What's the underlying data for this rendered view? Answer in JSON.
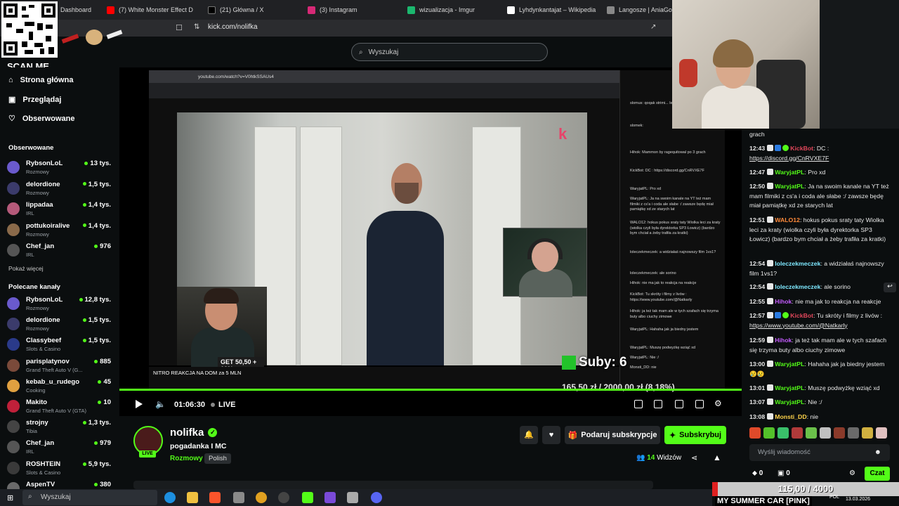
{
  "browser": {
    "tabs": [
      "Dashboard",
      "(7) White Monster Effect D",
      "(21) Główna / X",
      "(3) Instagram",
      "wizualizacja - Imgur",
      "Lyhdynkantajat – Wikipedia",
      "Langosze | AniaGotuje"
    ],
    "url": "kick.com/nolifka"
  },
  "overlay": {
    "scan_me": "SCAN ME",
    "suby": "Suby: 6",
    "goal_text": "165,50 zł / 2000,00 zł (8,18%)",
    "goal2_text": "115,00 / 4000",
    "song": "MY SUMMER CAR [PINK]"
  },
  "header": {
    "search_placeholder": "Wyszukaj"
  },
  "sidebar": {
    "nav": [
      "Strona główna",
      "Przeglądaj",
      "Obserwowane"
    ],
    "followed_title": "Obserwowane",
    "followed": [
      {
        "name": "RybsonLoL",
        "category": "Rozmowy",
        "viewers": "13 tys.",
        "color": "#6a5acd"
      },
      {
        "name": "delordione",
        "category": "Rozmowy",
        "viewers": "1,5 tys.",
        "color": "#3b3b6b"
      },
      {
        "name": "lippadaa",
        "category": "IRL",
        "viewers": "1,4 tys.",
        "color": "#b55a7a"
      },
      {
        "name": "pottukoiralive",
        "category": "Rozmowy",
        "viewers": "1,4 tys.",
        "color": "#8a6a4a"
      },
      {
        "name": "Chef_jan",
        "category": "IRL",
        "viewers": "976",
        "color": "#555555"
      }
    ],
    "show_more": "Pokaż więcej",
    "recommended_title": "Polecane kanały",
    "recommended": [
      {
        "name": "RybsonLoL",
        "category": "Rozmowy",
        "viewers": "12,8 tys.",
        "color": "#6a5acd"
      },
      {
        "name": "delordione",
        "category": "Rozmowy",
        "viewers": "1,5 tys.",
        "color": "#3b3b6b"
      },
      {
        "name": "Classybeef",
        "category": "Slots & Casino",
        "viewers": "1,5 tys.",
        "color": "#2a3a8a"
      },
      {
        "name": "parisplatynov",
        "category": "Grand Theft Auto V (G...",
        "viewers": "885",
        "color": "#7a4a3a"
      },
      {
        "name": "kebab_u_rudego",
        "category": "Cooking",
        "viewers": "45",
        "color": "#e0a040"
      },
      {
        "name": "Makito",
        "category": "Grand Theft Auto V (GTA)",
        "viewers": "10",
        "color": "#c0203a"
      },
      {
        "name": "strojny",
        "category": "Tibia",
        "viewers": "1,3 tys.",
        "color": "#444444"
      },
      {
        "name": "Chef_jan",
        "category": "IRL",
        "viewers": "979",
        "color": "#555555"
      },
      {
        "name": "ROSHTEIN",
        "category": "Slots & Casino",
        "viewers": "5,9 tys.",
        "color": "#3a3a3a"
      },
      {
        "name": "AspenTV",
        "category": "",
        "viewers": "380",
        "color": "#6a6a6a"
      }
    ]
  },
  "video": {
    "inner_url": "youtube.com/watch?v=V0htkSSAUs4",
    "inner_title": "NITRO REAKCJA NA DOM za 5 MLN",
    "get_text": "GET 50,50 + 10%",
    "time": "01:06:30",
    "live": "LIVE",
    "yt_chat": [
      "slomus: qoqak strimi... lepsza jakosc od meduski xD",
      "slomek:",
      "Hihok: Mammon by ragequitowal po 3 grach",
      "KickBot: DC : https://discord.gg/CnRVXE7F",
      "WaryjatPL: Pro xd",
      "WaryjatPL: Ja na swoim kanale na YT też mam filmiki z cs'a i coda ale słabe :/ zawsze będę miał pamiątkę xd ze starych lat",
      "WALO12: hokus pokus sraty taty Wiolka leci za kraty (wiolka czyli była dyrektorka SP3 Łowicz) (bardzo bym chciał a żeby trafiła za kratki)",
      "loleczekmeczek: a widziałaś najnowszy film 1vs1?",
      "loleczekmeczek: ale sorino",
      "Hihok: nie ma jak to reakcja na reakcje",
      "KickBot: Tu skróty i filmy z livów : https://www.youtube.com/@Natkarly",
      "Hihok: ja też tak mam ale w tych szafach się trzyma buty albo ciuchy zimowe",
      "WaryjatPL: Hahaha jak ja biedny jestem",
      "WaryjatPL: Muszę podwyżkę wziąć xd",
      "WaryjatPL: Nie :/",
      "Monsti_DD: nie"
    ]
  },
  "streamer": {
    "name": "nolifka",
    "title": "pogadanka I MC",
    "category": "Rozmowy",
    "language": "Polish",
    "live_badge": "LIVE",
    "gift_label": "Podaruj subskrypcje",
    "subscribe_label": "Subskrybuj",
    "viewers_count": "14",
    "viewers_label": "Widzów"
  },
  "chat": {
    "messages": [
      {
        "time": "",
        "user": "",
        "color": "#ffffff",
        "text": "grach"
      },
      {
        "time": "12:43",
        "user": "KickBot",
        "color": "#e0465a",
        "text": "DC : ",
        "link": "https://discord.gg/CnRVXE7F"
      },
      {
        "time": "12:47",
        "user": "WaryjatPL",
        "color": "#53fc18",
        "text": "Pro xd"
      },
      {
        "time": "12:50",
        "user": "WaryjatPL",
        "color": "#53fc18",
        "text": "Ja na swoim kanale na YT też mam filmiki z cs'a i coda ale słabe :/ zawsze będę miał pamiątkę xd ze starych lat"
      },
      {
        "time": "12:51",
        "user": "WALO12",
        "color": "#ff8a3a",
        "text": "hokus pokus sraty taty Wiolka leci za kraty (wiolka czyli była dyrektorka SP3 Łowicz) (bardzo bym chciał a żeby trafiła za kratki)"
      },
      {
        "time": "12:54",
        "user": "loleczekmeczek",
        "color": "#7ee8ff",
        "text": "a widziałaś najnowszy film 1vs1?"
      },
      {
        "time": "12:54",
        "user": "loleczekmeczek",
        "color": "#7ee8ff",
        "text": "ale sorino"
      },
      {
        "time": "12:55",
        "user": "Hihok",
        "color": "#c45cff",
        "text": "nie ma jak to reakcja na reakcje"
      },
      {
        "time": "12:57",
        "user": "KickBot",
        "color": "#e0465a",
        "text": "Tu skróty i filmy z livów : ",
        "link": "https://www.youtube.com/@Natkarly"
      },
      {
        "time": "12:59",
        "user": "Hihok",
        "color": "#c45cff",
        "text": "ja też tak mam ale w tych szafach się trzyma buty albo ciuchy zimowe"
      },
      {
        "time": "13:00",
        "user": "WaryjatPL",
        "color": "#53fc18",
        "text": "Hahaha jak ja biedny jestem 😢😢"
      },
      {
        "time": "13:01",
        "user": "WaryjatPL",
        "color": "#53fc18",
        "text": "Muszę podwyżkę wziąć xd"
      },
      {
        "time": "13:07",
        "user": "WaryjatPL",
        "color": "#53fc18",
        "text": "Nie :/"
      },
      {
        "time": "13:08",
        "user": "Monsti_DD",
        "color": "#ffd24a",
        "text": "nie"
      }
    ],
    "input_placeholder": "Wyślij wiadomość",
    "footer_left_1": "0",
    "footer_left_2": "0",
    "send_label": "Czat"
  },
  "taskbar": {
    "search": "Wyszukaj",
    "date": "13.03.2026",
    "lang": "POL"
  }
}
